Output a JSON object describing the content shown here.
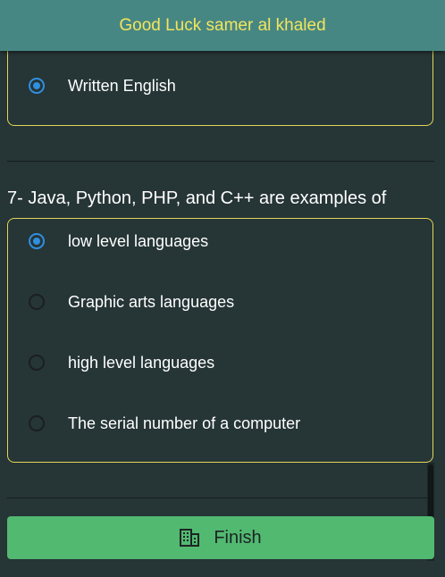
{
  "header": {
    "title": "Good Luck samer al khaled"
  },
  "previous_question": {
    "options": [
      {
        "label": "Written English",
        "selected": true
      }
    ]
  },
  "question": {
    "text": "7- Java, Python, PHP, and C++ are examples of",
    "options": [
      {
        "label": "low level languages",
        "selected": true
      },
      {
        "label": "Graphic arts languages",
        "selected": false
      },
      {
        "label": "high level languages",
        "selected": false
      },
      {
        "label": "The serial number of a computer",
        "selected": false
      }
    ]
  },
  "footer": {
    "finish_label": "Finish",
    "finish_icon": "calculator-icon"
  },
  "colors": {
    "header_bg": "#478783",
    "header_text": "#f2e55e",
    "page_bg": "#263536",
    "box_border": "#e3d65a",
    "radio_selected": "#2f8fe0",
    "finish_bg": "#52b971"
  }
}
